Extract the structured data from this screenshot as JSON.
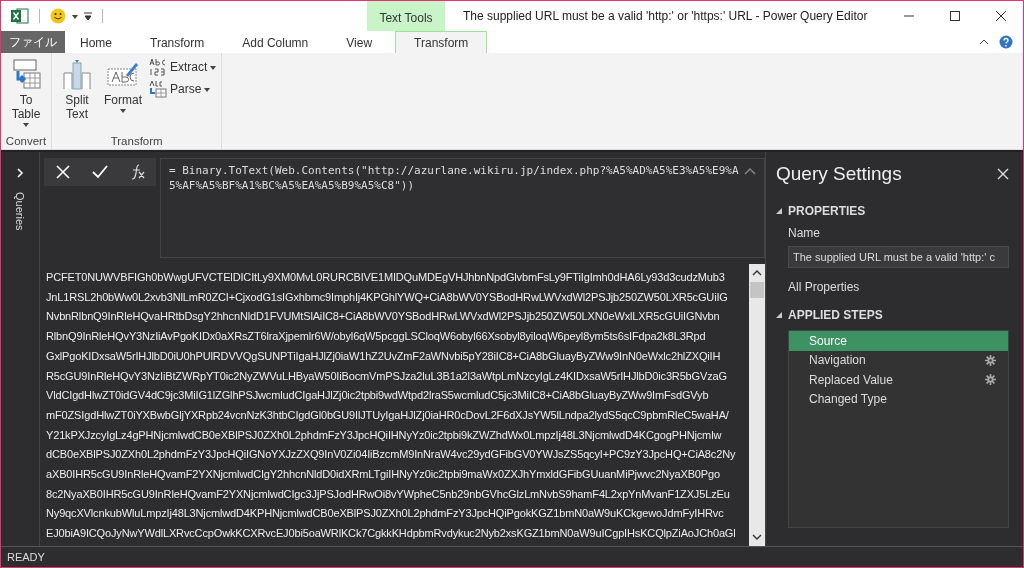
{
  "window": {
    "title": "The supplied URL must be a valid 'http:' or 'https:' URL - Power Query Editor",
    "context_label": "Text Tools"
  },
  "file_tab": "ファイル",
  "tabs": [
    {
      "label": "Home",
      "selected": false
    },
    {
      "label": "Transform",
      "selected": false
    },
    {
      "label": "Add Column",
      "selected": false
    },
    {
      "label": "View",
      "selected": false
    },
    {
      "label": "Transform",
      "selected": true
    }
  ],
  "ribbon_groups": [
    {
      "label": "Convert",
      "items": [
        {
          "kind": "large",
          "label": "To Table",
          "dropdown": true
        }
      ]
    },
    {
      "label": "Transform",
      "items": [
        {
          "kind": "large",
          "label": "Split Text",
          "dropdown": false
        },
        {
          "kind": "large",
          "label": "Format",
          "dropdown": true
        },
        {
          "kind": "stack",
          "items": [
            {
              "label": "Extract",
              "dropdown": true
            },
            {
              "label": "Parse",
              "dropdown": true
            }
          ]
        }
      ]
    }
  ],
  "queries_pane": {
    "label": "Queries"
  },
  "formula": "= Binary.ToText(Web.Contents(\"http://azurlane.wikiru.jp/index.php?%A5%AD%A5%E3%A5%E9%A5%AF%A5%BF%A1%BC%A5%EA%A5%B9%A5%C8\"))",
  "result_lines": [
    "PCFET0NUWVBFIGh0bWwgUFVCTElDICItLy9XM0MvL0RURCBIVE1MIDQuMDEgVHJhbnNpdGlvbmFsLy9FTiIgImh0dHA6Ly93d3cudzMub3",
    "JnL1RSL2h0bWw0L2xvb3NlLmR0ZCI+CjxodG1sIGxhbmc9ImphIj4KPGhlYWQ+CiA8bWV0YSBodHRwLWVxdWl2PSJjb250ZW50LXR5cGUiIG",
    "NvbnRlbnQ9InRleHQvaHRtbDsgY2hhcnNldD1FVUMtSlAiIC8+CiA8bWV0YSBodHRwLWVxdWl2PSJjb250ZW50LXN0eWxlLXR5cGUiIGNvbn",
    "RlbnQ9InRleHQvY3NzIiAvPgoKIDx0aXRsZT6lraXjpemlr6W/obyl6qW5pcggLSCloqW6obyl66Xsobyl8yiloqW6peyl8ym5ts6sIFdpa2k8L3Rpd",
    "GxlPgoKIDxsaW5rIHJlbD0iU0hPUlRDVVQgSUNPTiIgaHJlZj0iaW1hZ2UvZmF2aWNvbi5pY28iIC8+CiA8bGluayByZWw9InN0eWxlc2hlZXQiIH",
    "R5cGU9InRleHQvY3NzIiBtZWRpYT0ic2NyZWVuLHByaW50IiBocmVmPSJza2luL3B1a2l3aWtpLmNzcyIgLz4KIDxsaW5rIHJlbD0ic3R5bGVzaG",
    "VldCIgdHlwZT0idGV4dC9jc3MiIG1lZGlhPSJwcmludCIgaHJlZj0ic2tpbi9wdWtpd2lraS5wcmludC5jc3MiIC8+CiA8bGluayByZWw9ImFsdGVyb",
    "mF0ZSIgdHlwZT0iYXBwbGljYXRpb24vcnNzK3htbCIgdGl0bGU9IlJTUyIgaHJlZj0iaHR0cDovL2F6dXJsYW5lLndpa2lydS5qcC9pbmRleC5waHA/",
    "Y21kPXJzcyIgLz4gPHNjcmlwdCB0eXBlPSJ0ZXh0L2phdmFzY3JpcHQiIHNyYz0ic2tpbi9kZWZhdWx0LmpzIj48L3NjcmlwdD4KCgogPHNjcmlw",
    "dCB0eXBlPSJ0ZXh0L2phdmFzY3JpcHQiIGNoYXJzZXQ9InV0Zi04IiBzcmM9InNraW4vc29ydGFibGV0YWJsZS5qcyI+PC9zY3JpcHQ+CiA8c2Ny",
    "aXB0IHR5cGU9InRleHQvamF2YXNjcmlwdCIgY2hhcnNldD0idXRmLTgiIHNyYz0ic2tpbi9maWx0ZXJhYmxldGFibGUuanMiPjwvc2NyaXB0Pgo",
    "8c2NyaXB0IHR5cGU9InRleHQvamF2YXNjcmlwdCIgc3JjPSJodHRwOi8vYWpheC5nb29nbGVhcGlzLmNvbS9hamF4L2xpYnMvanF1ZXJ5LzEu",
    "Ny9qcXVlcnkubWluLmpzIj48L3NjcmlwdD4KPHNjcmlwdCB0eXBlPSJ0ZXh0L2phdmFzY3JpcHQiPgokKGZ1bmN0aW9uKCkgewoJdmFyIHRvc",
    "EJ0biA9ICQoJyNwYWdlLXRvcCcpOwkKCXRvcEJ0bi5oaWRlKCk7CgkkKHdpbmRvdykuc2Nyb2xsKGZ1bmN0aW9uICgpIHsKCQlpZiAoJCh0aGl"
  ],
  "query_settings": {
    "title": "Query Settings",
    "properties_heading": "PROPERTIES",
    "name_label": "Name",
    "name_value": "The supplied URL must be a valid 'http:' c",
    "all_properties": "All Properties",
    "steps_heading": "APPLIED STEPS",
    "steps": [
      {
        "label": "Source",
        "selected": true,
        "has_settings": false
      },
      {
        "label": "Navigation",
        "selected": false,
        "has_settings": true
      },
      {
        "label": "Replaced Value",
        "selected": false,
        "has_settings": true
      },
      {
        "label": "Changed Type",
        "selected": false,
        "has_settings": false
      }
    ]
  },
  "status_bar": "READY"
}
